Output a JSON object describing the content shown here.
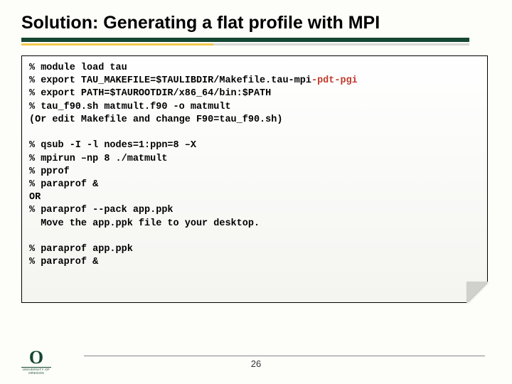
{
  "title": "Solution: Generating a flat profile with MPI",
  "code": {
    "l1": "% module load tau",
    "l2a": "% export TAU_MAKEFILE=$TAULIBDIR/Makefile.tau-mpi",
    "l2b": "-pdt-pgi",
    "l3": "% export PATH=$TAUROOTDIR/x86_64/bin:$PATH",
    "l4": "% tau_f90.sh matmult.f90 -o matmult",
    "l5": "(Or edit Makefile and change F90=tau_f90.sh)",
    "l6": "% qsub -I -l nodes=1:ppn=8 –X",
    "l7": "% mpirun –np 8 ./matmult",
    "l8": "% pprof",
    "l9": "% paraprof &",
    "l10": "OR",
    "l11": "% paraprof --pack app.ppk",
    "l12": "  Move the app.ppk file to your desktop.",
    "l13": "% paraprof app.ppk",
    "l14": "% paraprof &"
  },
  "footer": {
    "page": "26",
    "logo_main": "O",
    "logo_sub": "UNIVERSITY OF OREGON"
  }
}
